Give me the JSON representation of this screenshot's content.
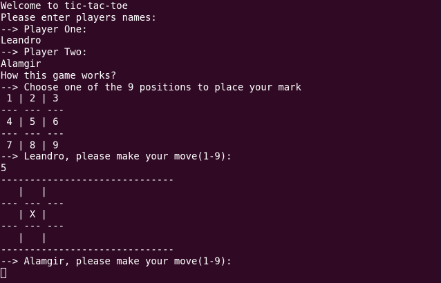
{
  "terminal": {
    "lines": [
      "Welcome to tic-tac-toe",
      "Please enter players names:",
      "--> Player One:",
      "Leandro",
      "--> Player Two:",
      "Alamgir",
      "How this game works?",
      "--> Choose one of the 9 positions to place your mark",
      " 1 | 2 | 3",
      "--- --- ---",
      " 4 | 5 | 6",
      "--- --- ---",
      " 7 | 8 | 9",
      "--> Leandro, please make your move(1-9):",
      "5",
      "------------------------------",
      "   |   |",
      "--- --- ---",
      "   | X |",
      "--- --- ---",
      "   |   |",
      "------------------------------",
      "--> Alamgir, please make your move(1-9):"
    ]
  }
}
